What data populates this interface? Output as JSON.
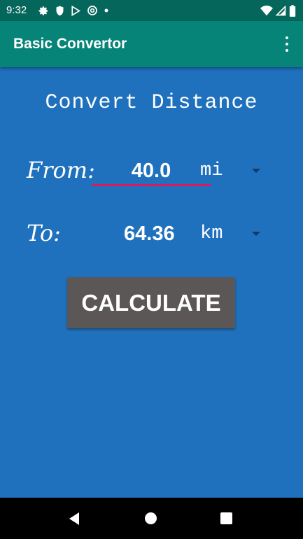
{
  "status_bar": {
    "time": "9:32",
    "icons_left": [
      "gear-icon",
      "shield-icon",
      "play-store-icon",
      "at-sign-icon",
      "dot-icon"
    ],
    "icons_right": [
      "wifi-icon",
      "signal-icon",
      "battery-icon"
    ]
  },
  "app_bar": {
    "title": "Basic Convertor",
    "overflow_icon": "more-vert-icon"
  },
  "main": {
    "heading": "Convert Distance",
    "from_label": "From:",
    "from_value": "40.0",
    "from_unit": "mi",
    "to_label": "To:",
    "to_value": "64.36",
    "to_unit": "km",
    "calculate_label": "CALCULATE"
  },
  "nav_bar": {
    "icons": [
      "back-icon",
      "home-icon",
      "recents-icon"
    ]
  },
  "colors": {
    "status_bar": "#05675b",
    "app_bar": "#068477",
    "content_bg": "#1f71bd",
    "input_underline": "#d81b60",
    "button_bg": "#5b5756"
  }
}
